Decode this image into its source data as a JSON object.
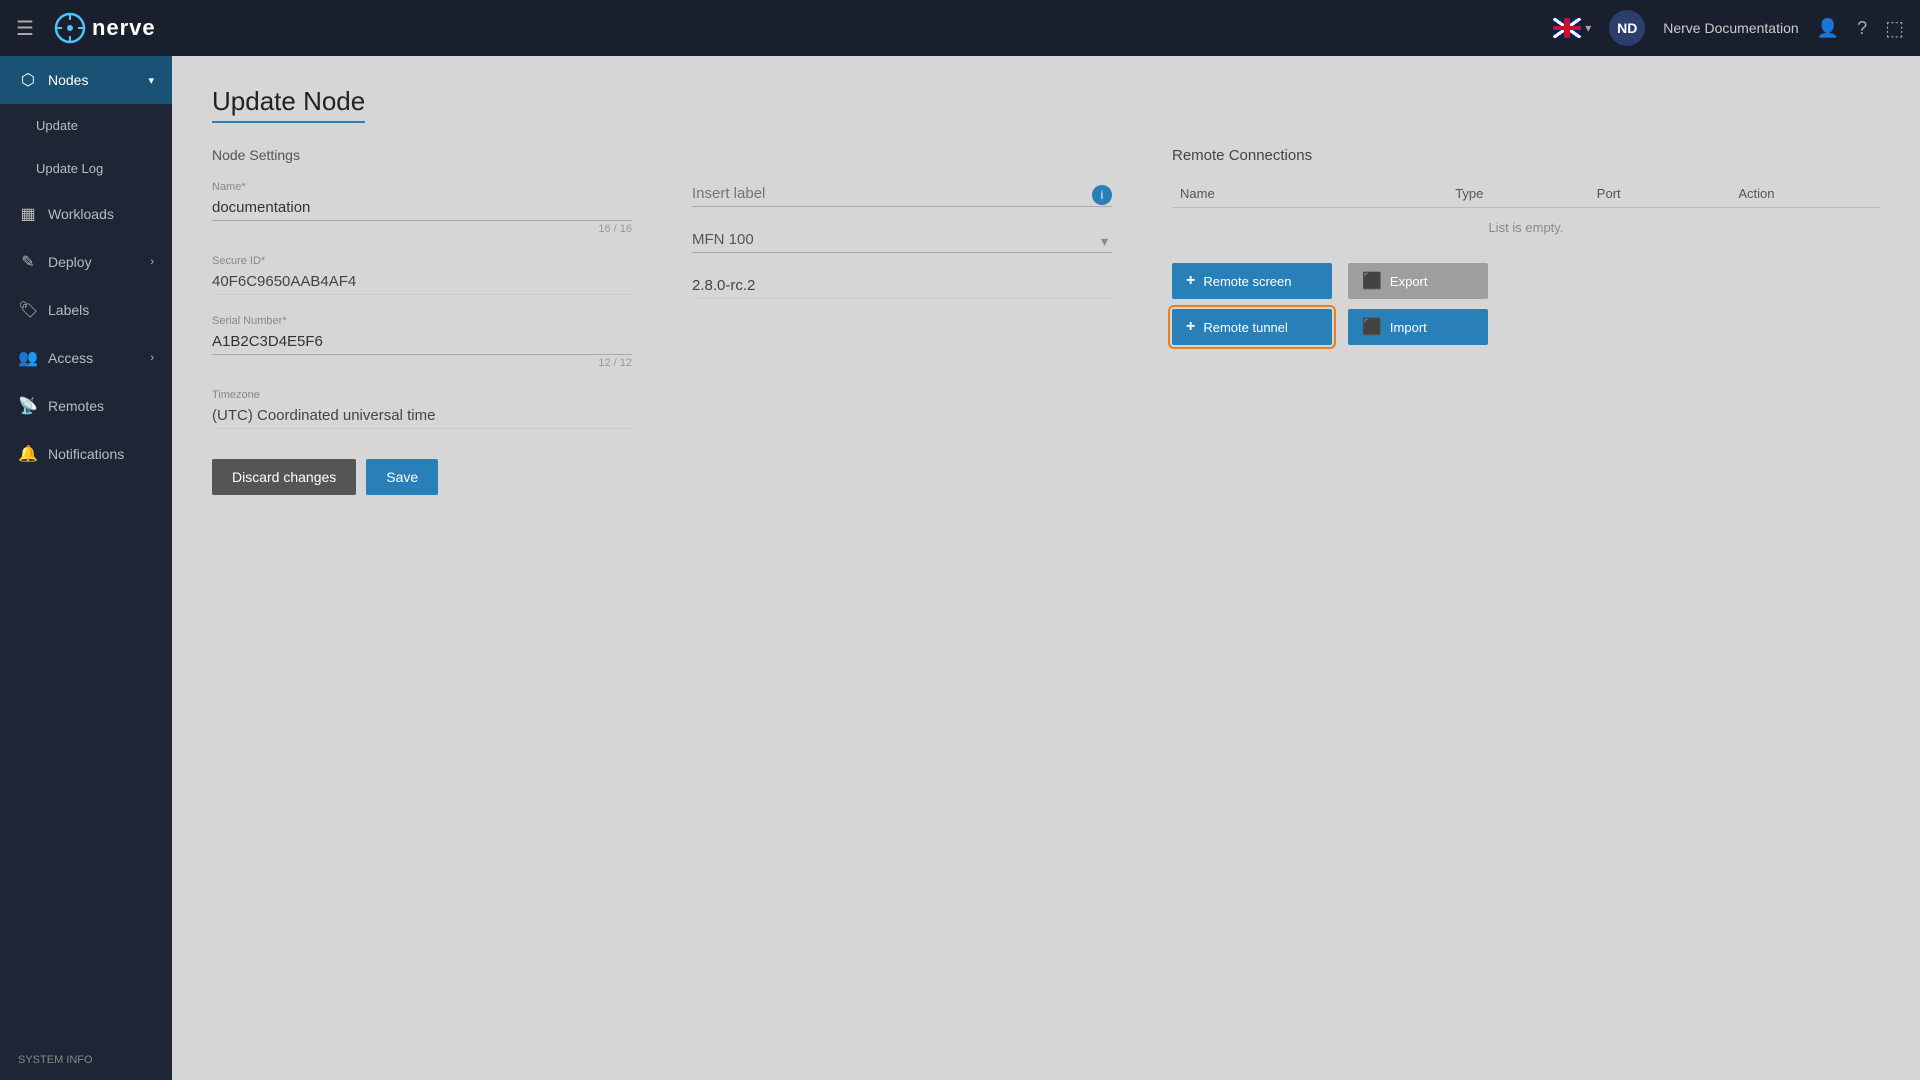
{
  "topnav": {
    "hamburger": "☰",
    "logo_text": "nerve",
    "nd_avatar": "ND",
    "doc_link": "Nerve Documentation",
    "user_icon": "👤",
    "help_icon": "?",
    "logout_icon": "⎋"
  },
  "sidebar": {
    "items": [
      {
        "id": "nodes",
        "label": "Nodes",
        "icon": "⬡",
        "active": true,
        "has_chevron": true
      },
      {
        "id": "update",
        "label": "Update",
        "icon": "",
        "active": false,
        "has_chevron": false,
        "indent": true
      },
      {
        "id": "update-log",
        "label": "Update Log",
        "icon": "",
        "active": false,
        "has_chevron": false,
        "indent": true
      },
      {
        "id": "workloads",
        "label": "Workloads",
        "icon": "▦",
        "active": false,
        "has_chevron": false
      },
      {
        "id": "deploy",
        "label": "Deploy",
        "icon": "✎",
        "active": false,
        "has_chevron": true
      },
      {
        "id": "labels",
        "label": "Labels",
        "icon": "🏷",
        "active": false,
        "has_chevron": false
      },
      {
        "id": "access",
        "label": "Access",
        "icon": "👥",
        "active": false,
        "has_chevron": true
      },
      {
        "id": "remotes",
        "label": "Remotes",
        "icon": "📡",
        "active": false,
        "has_chevron": false
      },
      {
        "id": "notifications",
        "label": "Notifications",
        "icon": "🔔",
        "active": false,
        "has_chevron": false
      }
    ],
    "system_info": "SYSTEM INFO"
  },
  "page": {
    "title": "Update Node",
    "node_settings_label": "Node Settings",
    "name_label": "Name*",
    "name_value": "documentation",
    "name_hint": "16 / 16",
    "secure_id_label": "Secure ID*",
    "secure_id_value": "40F6C9650AAB4AF4",
    "serial_number_label": "Serial Number*",
    "serial_number_value": "A1B2C3D4E5F6",
    "serial_number_hint": "12 / 12",
    "timezone_label": "Timezone",
    "timezone_value": "(UTC) Coordinated universal time",
    "label_placeholder": "Insert label",
    "model_value": "MFN 100",
    "version_value": "2.8.0-rc.2",
    "discard_label": "Discard changes",
    "save_label": "Save"
  },
  "remote_connections": {
    "heading": "Remote Connections",
    "col_name": "Name",
    "col_type": "Type",
    "col_port": "Port",
    "col_action": "Action",
    "empty_text": "List is empty.",
    "btn_remote_screen": "Remote screen",
    "btn_remote_tunnel": "Remote tunnel",
    "btn_export": "Export",
    "btn_import": "Import"
  }
}
